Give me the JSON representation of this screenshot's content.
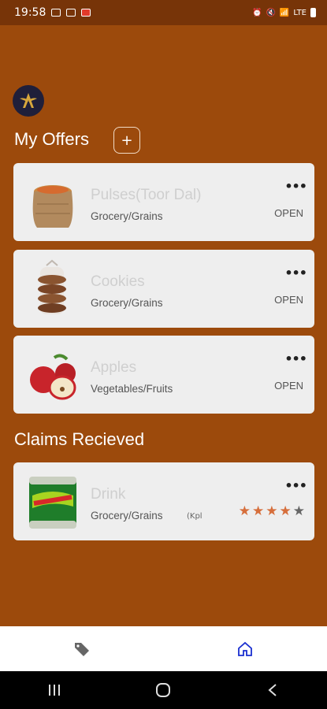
{
  "status_bar": {
    "time": "19:58",
    "network": "Vo) LTE1",
    "network_speed": "LTE"
  },
  "my_offers": {
    "title": "My Offers",
    "add_label": "+",
    "items": [
      {
        "title": "Pulses(Toor Dal)",
        "category": "Grocery/Grains",
        "status": "OPEN",
        "menu": "•••",
        "icon": "sack-icon"
      },
      {
        "title": "Cookies",
        "category": "Grocery/Grains",
        "status": "OPEN",
        "menu": "•••",
        "icon": "cookies-icon"
      },
      {
        "title": "Apples",
        "category": "Vegetables/Fruits",
        "status": "OPEN",
        "menu": "•••",
        "icon": "apple-icon"
      }
    ]
  },
  "claims": {
    "title": "Claims Recieved",
    "items": [
      {
        "title": "Drink",
        "category": "Grocery/Grains",
        "tag": "(Kpl",
        "menu": "•••",
        "rating": 4,
        "max_rating": 5,
        "icon": "soda-can-icon"
      }
    ]
  },
  "bottom_nav": {
    "items": [
      {
        "icon": "tag-icon"
      },
      {
        "icon": "home-icon"
      }
    ]
  },
  "colors": {
    "background": "#9c4a0c",
    "status_bar": "#773408",
    "card": "#eeeeee",
    "star_on": "#d66e3b",
    "home_active": "#1a2fd0"
  }
}
